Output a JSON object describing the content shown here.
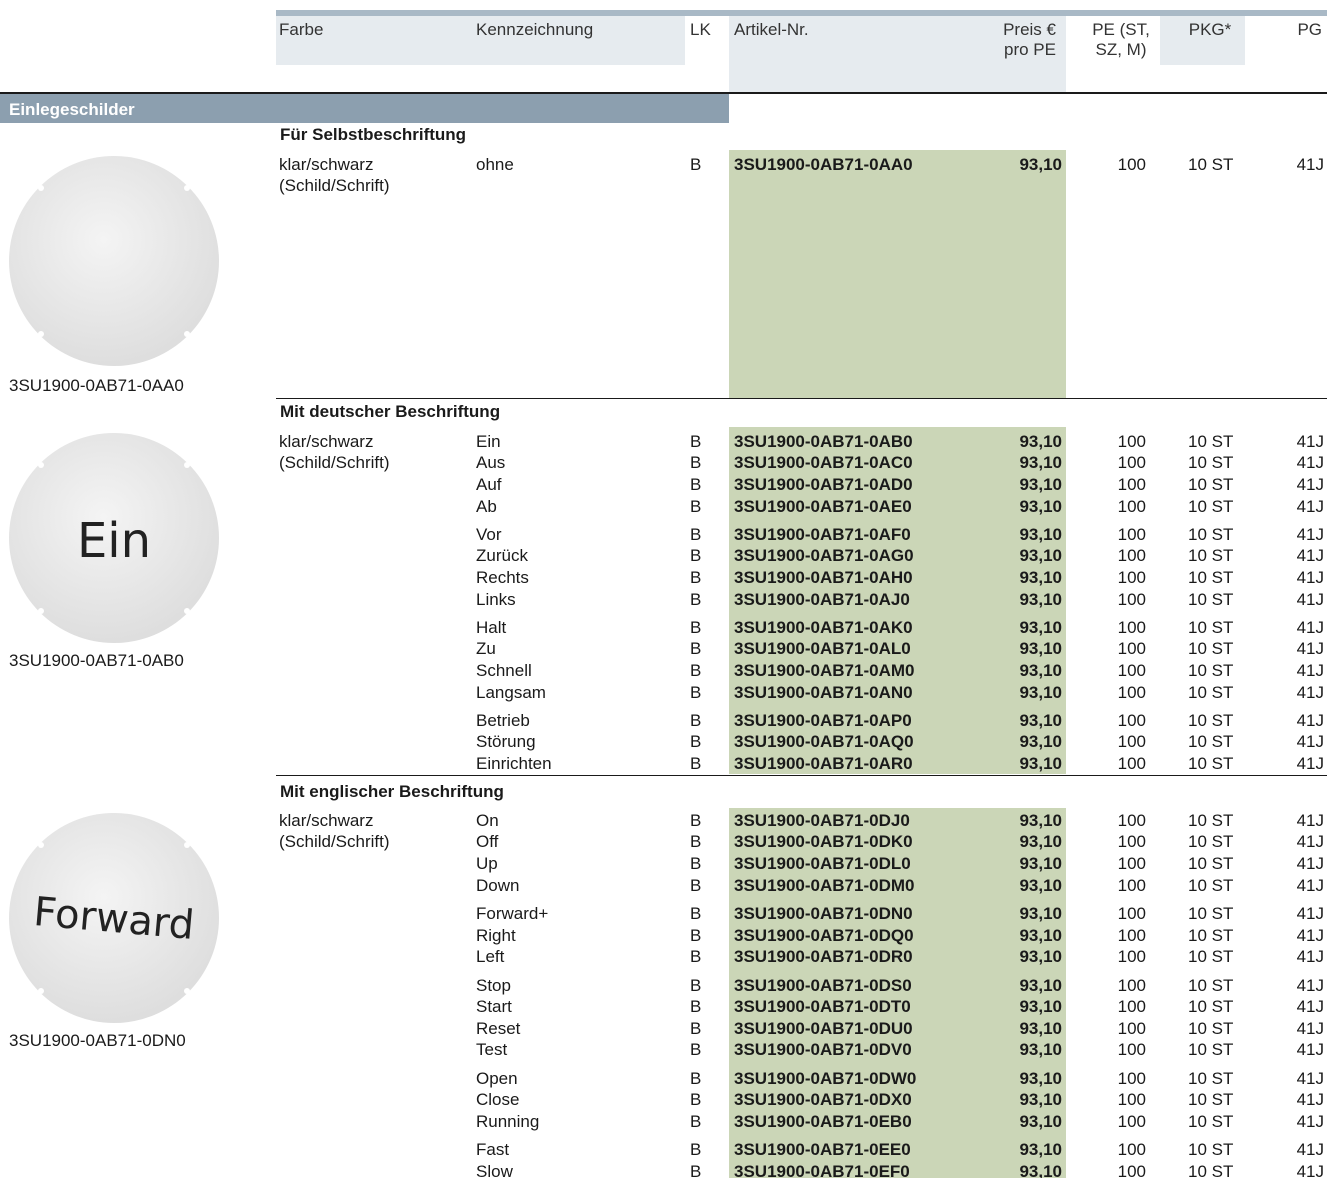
{
  "header": {
    "farbe": "Farbe",
    "kennzeichnung": "Kennzeichnung",
    "lk": "LK",
    "artikel": "Artikel-Nr.",
    "preis_1": "Preis €",
    "preis_2": "pro PE",
    "pe_1": "PE (ST,",
    "pe_2": "SZ, M)",
    "pkg": "PKG*",
    "pg": "PG"
  },
  "section_title": "Einlegeschilder",
  "images": [
    {
      "caption": "3SU1900-0AB71-0AA0",
      "disc_text": ""
    },
    {
      "caption": "3SU1900-0AB71-0AB0",
      "disc_text": "Ein"
    },
    {
      "caption": "3SU1900-0AB71-0DN0",
      "disc_text": "Forward"
    }
  ],
  "groups": [
    {
      "title": "Für Selbstbeschriftung",
      "farbe_1": "klar/schwarz",
      "farbe_2": "(Schild/Schrift)",
      "rows": [
        {
          "k": "ohne",
          "lk": "B",
          "art": "3SU1900-0AB71-0AA0",
          "preis": "93,10",
          "pe": "100",
          "pkg": "10 ST",
          "pg": "41J"
        }
      ]
    },
    {
      "title": "Mit deutscher Beschriftung",
      "farbe_1": "klar/schwarz",
      "farbe_2": "(Schild/Schrift)",
      "rows": [
        {
          "k": "Ein",
          "lk": "B",
          "art": "3SU1900-0AB71-0AB0",
          "preis": "93,10",
          "pe": "100",
          "pkg": "10 ST",
          "pg": "41J"
        },
        {
          "k": "Aus",
          "lk": "B",
          "art": "3SU1900-0AB71-0AC0",
          "preis": "93,10",
          "pe": "100",
          "pkg": "10 ST",
          "pg": "41J"
        },
        {
          "k": "Auf",
          "lk": "B",
          "art": "3SU1900-0AB71-0AD0",
          "preis": "93,10",
          "pe": "100",
          "pkg": "10 ST",
          "pg": "41J"
        },
        {
          "k": "Ab",
          "lk": "B",
          "art": "3SU1900-0AB71-0AE0",
          "preis": "93,10",
          "pe": "100",
          "pkg": "10 ST",
          "pg": "41J"
        },
        {
          "k": "Vor",
          "lk": "B",
          "art": "3SU1900-0AB71-0AF0",
          "preis": "93,10",
          "pe": "100",
          "pkg": "10 ST",
          "pg": "41J"
        },
        {
          "k": "Zurück",
          "lk": "B",
          "art": "3SU1900-0AB71-0AG0",
          "preis": "93,10",
          "pe": "100",
          "pkg": "10 ST",
          "pg": "41J"
        },
        {
          "k": "Rechts",
          "lk": "B",
          "art": "3SU1900-0AB71-0AH0",
          "preis": "93,10",
          "pe": "100",
          "pkg": "10 ST",
          "pg": "41J"
        },
        {
          "k": "Links",
          "lk": "B",
          "art": "3SU1900-0AB71-0AJ0",
          "preis": "93,10",
          "pe": "100",
          "pkg": "10 ST",
          "pg": "41J"
        },
        {
          "k": "Halt",
          "lk": "B",
          "art": "3SU1900-0AB71-0AK0",
          "preis": "93,10",
          "pe": "100",
          "pkg": "10 ST",
          "pg": "41J"
        },
        {
          "k": "Zu",
          "lk": "B",
          "art": "3SU1900-0AB71-0AL0",
          "preis": "93,10",
          "pe": "100",
          "pkg": "10 ST",
          "pg": "41J"
        },
        {
          "k": "Schnell",
          "lk": "B",
          "art": "3SU1900-0AB71-0AM0",
          "preis": "93,10",
          "pe": "100",
          "pkg": "10 ST",
          "pg": "41J"
        },
        {
          "k": "Langsam",
          "lk": "B",
          "art": "3SU1900-0AB71-0AN0",
          "preis": "93,10",
          "pe": "100",
          "pkg": "10 ST",
          "pg": "41J"
        },
        {
          "k": "Betrieb",
          "lk": "B",
          "art": "3SU1900-0AB71-0AP0",
          "preis": "93,10",
          "pe": "100",
          "pkg": "10 ST",
          "pg": "41J"
        },
        {
          "k": "Störung",
          "lk": "B",
          "art": "3SU1900-0AB71-0AQ0",
          "preis": "93,10",
          "pe": "100",
          "pkg": "10 ST",
          "pg": "41J"
        },
        {
          "k": "Einrichten",
          "lk": "B",
          "art": "3SU1900-0AB71-0AR0",
          "preis": "93,10",
          "pe": "100",
          "pkg": "10 ST",
          "pg": "41J"
        }
      ]
    },
    {
      "title": "Mit englischer Beschriftung",
      "farbe_1": "klar/schwarz",
      "farbe_2": "(Schild/Schrift)",
      "rows": [
        {
          "k": "On",
          "lk": "B",
          "art": "3SU1900-0AB71-0DJ0",
          "preis": "93,10",
          "pe": "100",
          "pkg": "10 ST",
          "pg": "41J"
        },
        {
          "k": "Off",
          "lk": "B",
          "art": "3SU1900-0AB71-0DK0",
          "preis": "93,10",
          "pe": "100",
          "pkg": "10 ST",
          "pg": "41J"
        },
        {
          "k": "Up",
          "lk": "B",
          "art": "3SU1900-0AB71-0DL0",
          "preis": "93,10",
          "pe": "100",
          "pkg": "10 ST",
          "pg": "41J"
        },
        {
          "k": "Down",
          "lk": "B",
          "art": "3SU1900-0AB71-0DM0",
          "preis": "93,10",
          "pe": "100",
          "pkg": "10 ST",
          "pg": "41J"
        },
        {
          "k": "Forward+",
          "lk": "B",
          "art": "3SU1900-0AB71-0DN0",
          "preis": "93,10",
          "pe": "100",
          "pkg": "10 ST",
          "pg": "41J"
        },
        {
          "k": "Right",
          "lk": "B",
          "art": "3SU1900-0AB71-0DQ0",
          "preis": "93,10",
          "pe": "100",
          "pkg": "10 ST",
          "pg": "41J"
        },
        {
          "k": "Left",
          "lk": "B",
          "art": "3SU1900-0AB71-0DR0",
          "preis": "93,10",
          "pe": "100",
          "pkg": "10 ST",
          "pg": "41J"
        },
        {
          "k": "Stop",
          "lk": "B",
          "art": "3SU1900-0AB71-0DS0",
          "preis": "93,10",
          "pe": "100",
          "pkg": "10 ST",
          "pg": "41J"
        },
        {
          "k": "Start",
          "lk": "B",
          "art": "3SU1900-0AB71-0DT0",
          "preis": "93,10",
          "pe": "100",
          "pkg": "10 ST",
          "pg": "41J"
        },
        {
          "k": "Reset",
          "lk": "B",
          "art": "3SU1900-0AB71-0DU0",
          "preis": "93,10",
          "pe": "100",
          "pkg": "10 ST",
          "pg": "41J"
        },
        {
          "k": "Test",
          "lk": "B",
          "art": "3SU1900-0AB71-0DV0",
          "preis": "93,10",
          "pe": "100",
          "pkg": "10 ST",
          "pg": "41J"
        },
        {
          "k": "Open",
          "lk": "B",
          "art": "3SU1900-0AB71-0DW0",
          "preis": "93,10",
          "pe": "100",
          "pkg": "10 ST",
          "pg": "41J"
        },
        {
          "k": "Close",
          "lk": "B",
          "art": "3SU1900-0AB71-0DX0",
          "preis": "93,10",
          "pe": "100",
          "pkg": "10 ST",
          "pg": "41J"
        },
        {
          "k": "Running",
          "lk": "B",
          "art": "3SU1900-0AB71-0EB0",
          "preis": "93,10",
          "pe": "100",
          "pkg": "10 ST",
          "pg": "41J"
        },
        {
          "k": "Fast",
          "lk": "B",
          "art": "3SU1900-0AB71-0EE0",
          "preis": "93,10",
          "pe": "100",
          "pkg": "10 ST",
          "pg": "41J"
        },
        {
          "k": "Slow",
          "lk": "B",
          "art": "3SU1900-0AB71-0EF0",
          "preis": "93,10",
          "pe": "100",
          "pkg": "10 ST",
          "pg": "41J"
        }
      ]
    }
  ]
}
